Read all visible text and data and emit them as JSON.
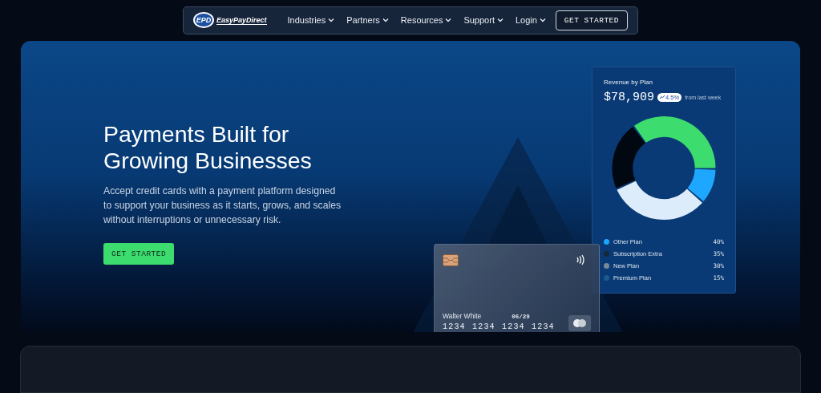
{
  "nav": {
    "logo": {
      "badge": "EPD",
      "wordmark": "EasyPayDirect"
    },
    "items": [
      {
        "label": "Industries"
      },
      {
        "label": "Partners"
      },
      {
        "label": "Resources"
      },
      {
        "label": "Support"
      },
      {
        "label": "Login"
      }
    ],
    "cta": "GET STARTED"
  },
  "hero": {
    "title": "Payments Built for Growing Businesses",
    "text": "Accept credit cards with a payment platform designed to support your business as it starts, grows, and scales without interruptions or unnecessary risk.",
    "cta": "GET STARTED"
  },
  "revenue": {
    "title": "Revenue by Plan",
    "amount": "$78,909",
    "change": "4.5%",
    "change_note": "from last week",
    "legend": [
      {
        "label": "Other Plan",
        "value": "40%",
        "color": "#1ea7ff"
      },
      {
        "label": "Subscription Extra",
        "value": "35%",
        "color": "#1b2638"
      },
      {
        "label": "New Plan",
        "value": "30%",
        "color": "#7b8696"
      },
      {
        "label": "Premium Plan",
        "value": "15%",
        "color": "#1d5a8c"
      }
    ]
  },
  "card": {
    "holder": "Walter White",
    "expiry": "06/29",
    "number": "1234 1234 1234 1234"
  }
}
